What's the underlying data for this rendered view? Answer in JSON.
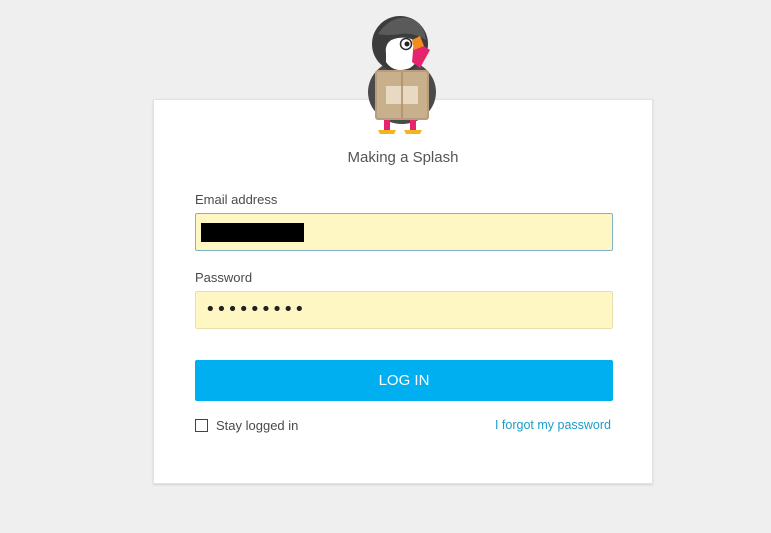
{
  "shop": {
    "name": "Making a Splash"
  },
  "form": {
    "email_label": "Email address",
    "email_value": "",
    "password_label": "Password",
    "password_value": "•••••••••",
    "login_button": "LOG IN",
    "stay_logged_in_label": "Stay logged in",
    "stay_logged_in_checked": false,
    "forgot_password_link": "I forgot my password"
  },
  "colors": {
    "background": "#efefef",
    "card": "#ffffff",
    "input_autofill": "#fff7c3",
    "primary_button": "#00aff0",
    "link": "#1d9dc8"
  },
  "icons": {
    "logo": "prestashop-puffin-logo"
  }
}
